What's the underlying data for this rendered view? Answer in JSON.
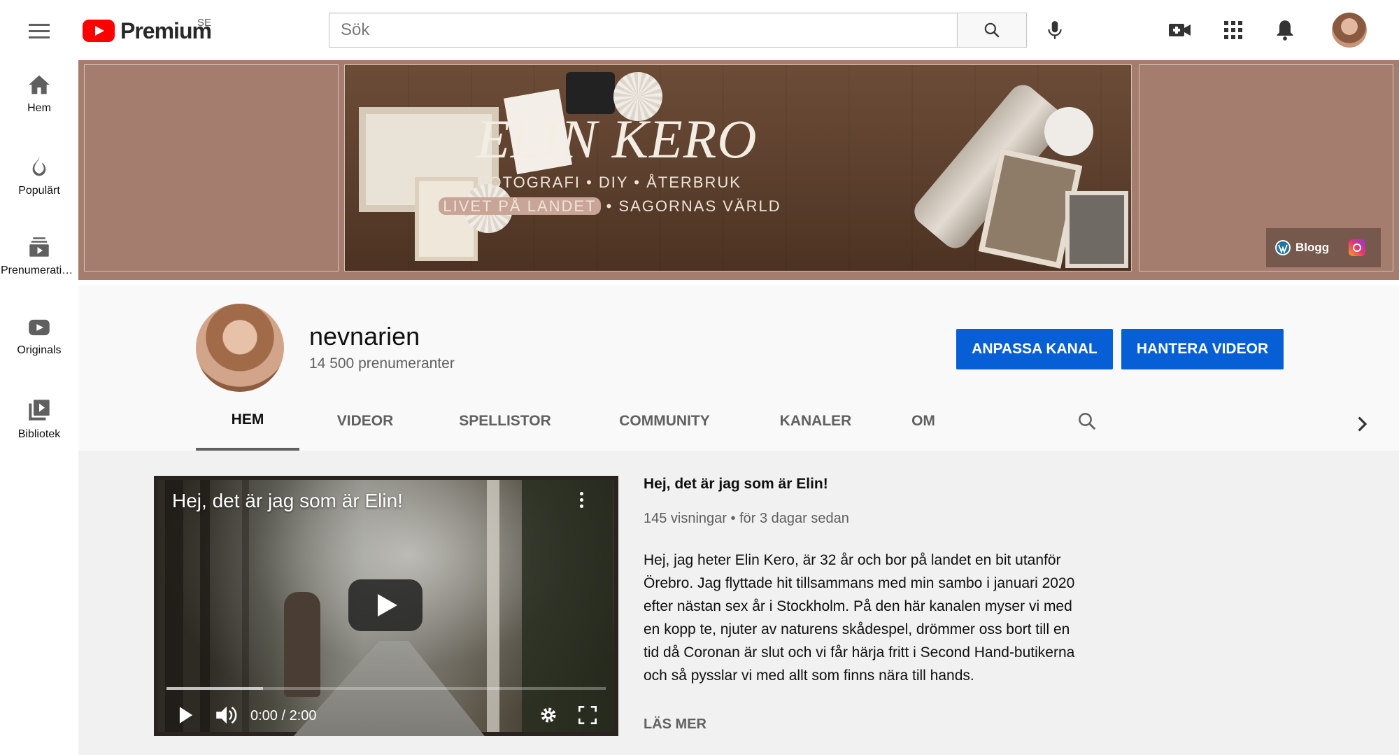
{
  "header": {
    "logo_text": "Premium",
    "region": "SE",
    "search_placeholder": "Sök"
  },
  "sidebar": {
    "items": [
      {
        "label": "Hem",
        "icon": "home-icon"
      },
      {
        "label": "Populärt",
        "icon": "flame-icon"
      },
      {
        "label": "Prenumerationer",
        "icon": "subscriptions-icon"
      },
      {
        "label": "Originals",
        "icon": "originals-icon"
      },
      {
        "label": "Bibliotek",
        "icon": "library-icon"
      }
    ]
  },
  "banner": {
    "title": "ELIN KERO",
    "subtitle_line1": "FOTOGRAFI • DIY • ÅTERBRUK",
    "subtitle_line2_highlight": "LIVET PÅ LANDET",
    "subtitle_line2_rest": " • SAGORNAS VÄRLD",
    "links": {
      "blog": "Blogg"
    },
    "bg_color": "#a47d6e"
  },
  "channel": {
    "name": "nevnarien",
    "subscribers": "14 500 prenumeranter",
    "customize_label": "ANPASSA KANAL",
    "manage_label": "HANTERA VIDEOR",
    "tabs": [
      "HEM",
      "VIDEOR",
      "SPELLISTOR",
      "COMMUNITY",
      "KANALER",
      "OM"
    ],
    "active_tab": "HEM",
    "accent_color": "#065fd4"
  },
  "featured_video": {
    "overlay_title": "Hej, det är jag som är Elin!",
    "time": "0:00 / 2:00",
    "progress": 0.22,
    "title": "Hej, det är jag som är Elin!",
    "meta": "145 visningar • för 3 dagar sedan",
    "description": "Hej, jag heter Elin Kero, är 32 år och bor på landet en bit utanför Örebro. Jag flyttade hit tillsammans med min sambo i januari 2020 efter nästan sex år i Stockholm. På den här kanalen myser vi med en kopp te, njuter av naturens skådespel, drömmer oss bort till en tid då Coronan är slut och vi får härja fritt i Second Hand-butikerna och så pysslar vi med allt som finns nära till hands.",
    "read_more": "LÄS MER"
  }
}
